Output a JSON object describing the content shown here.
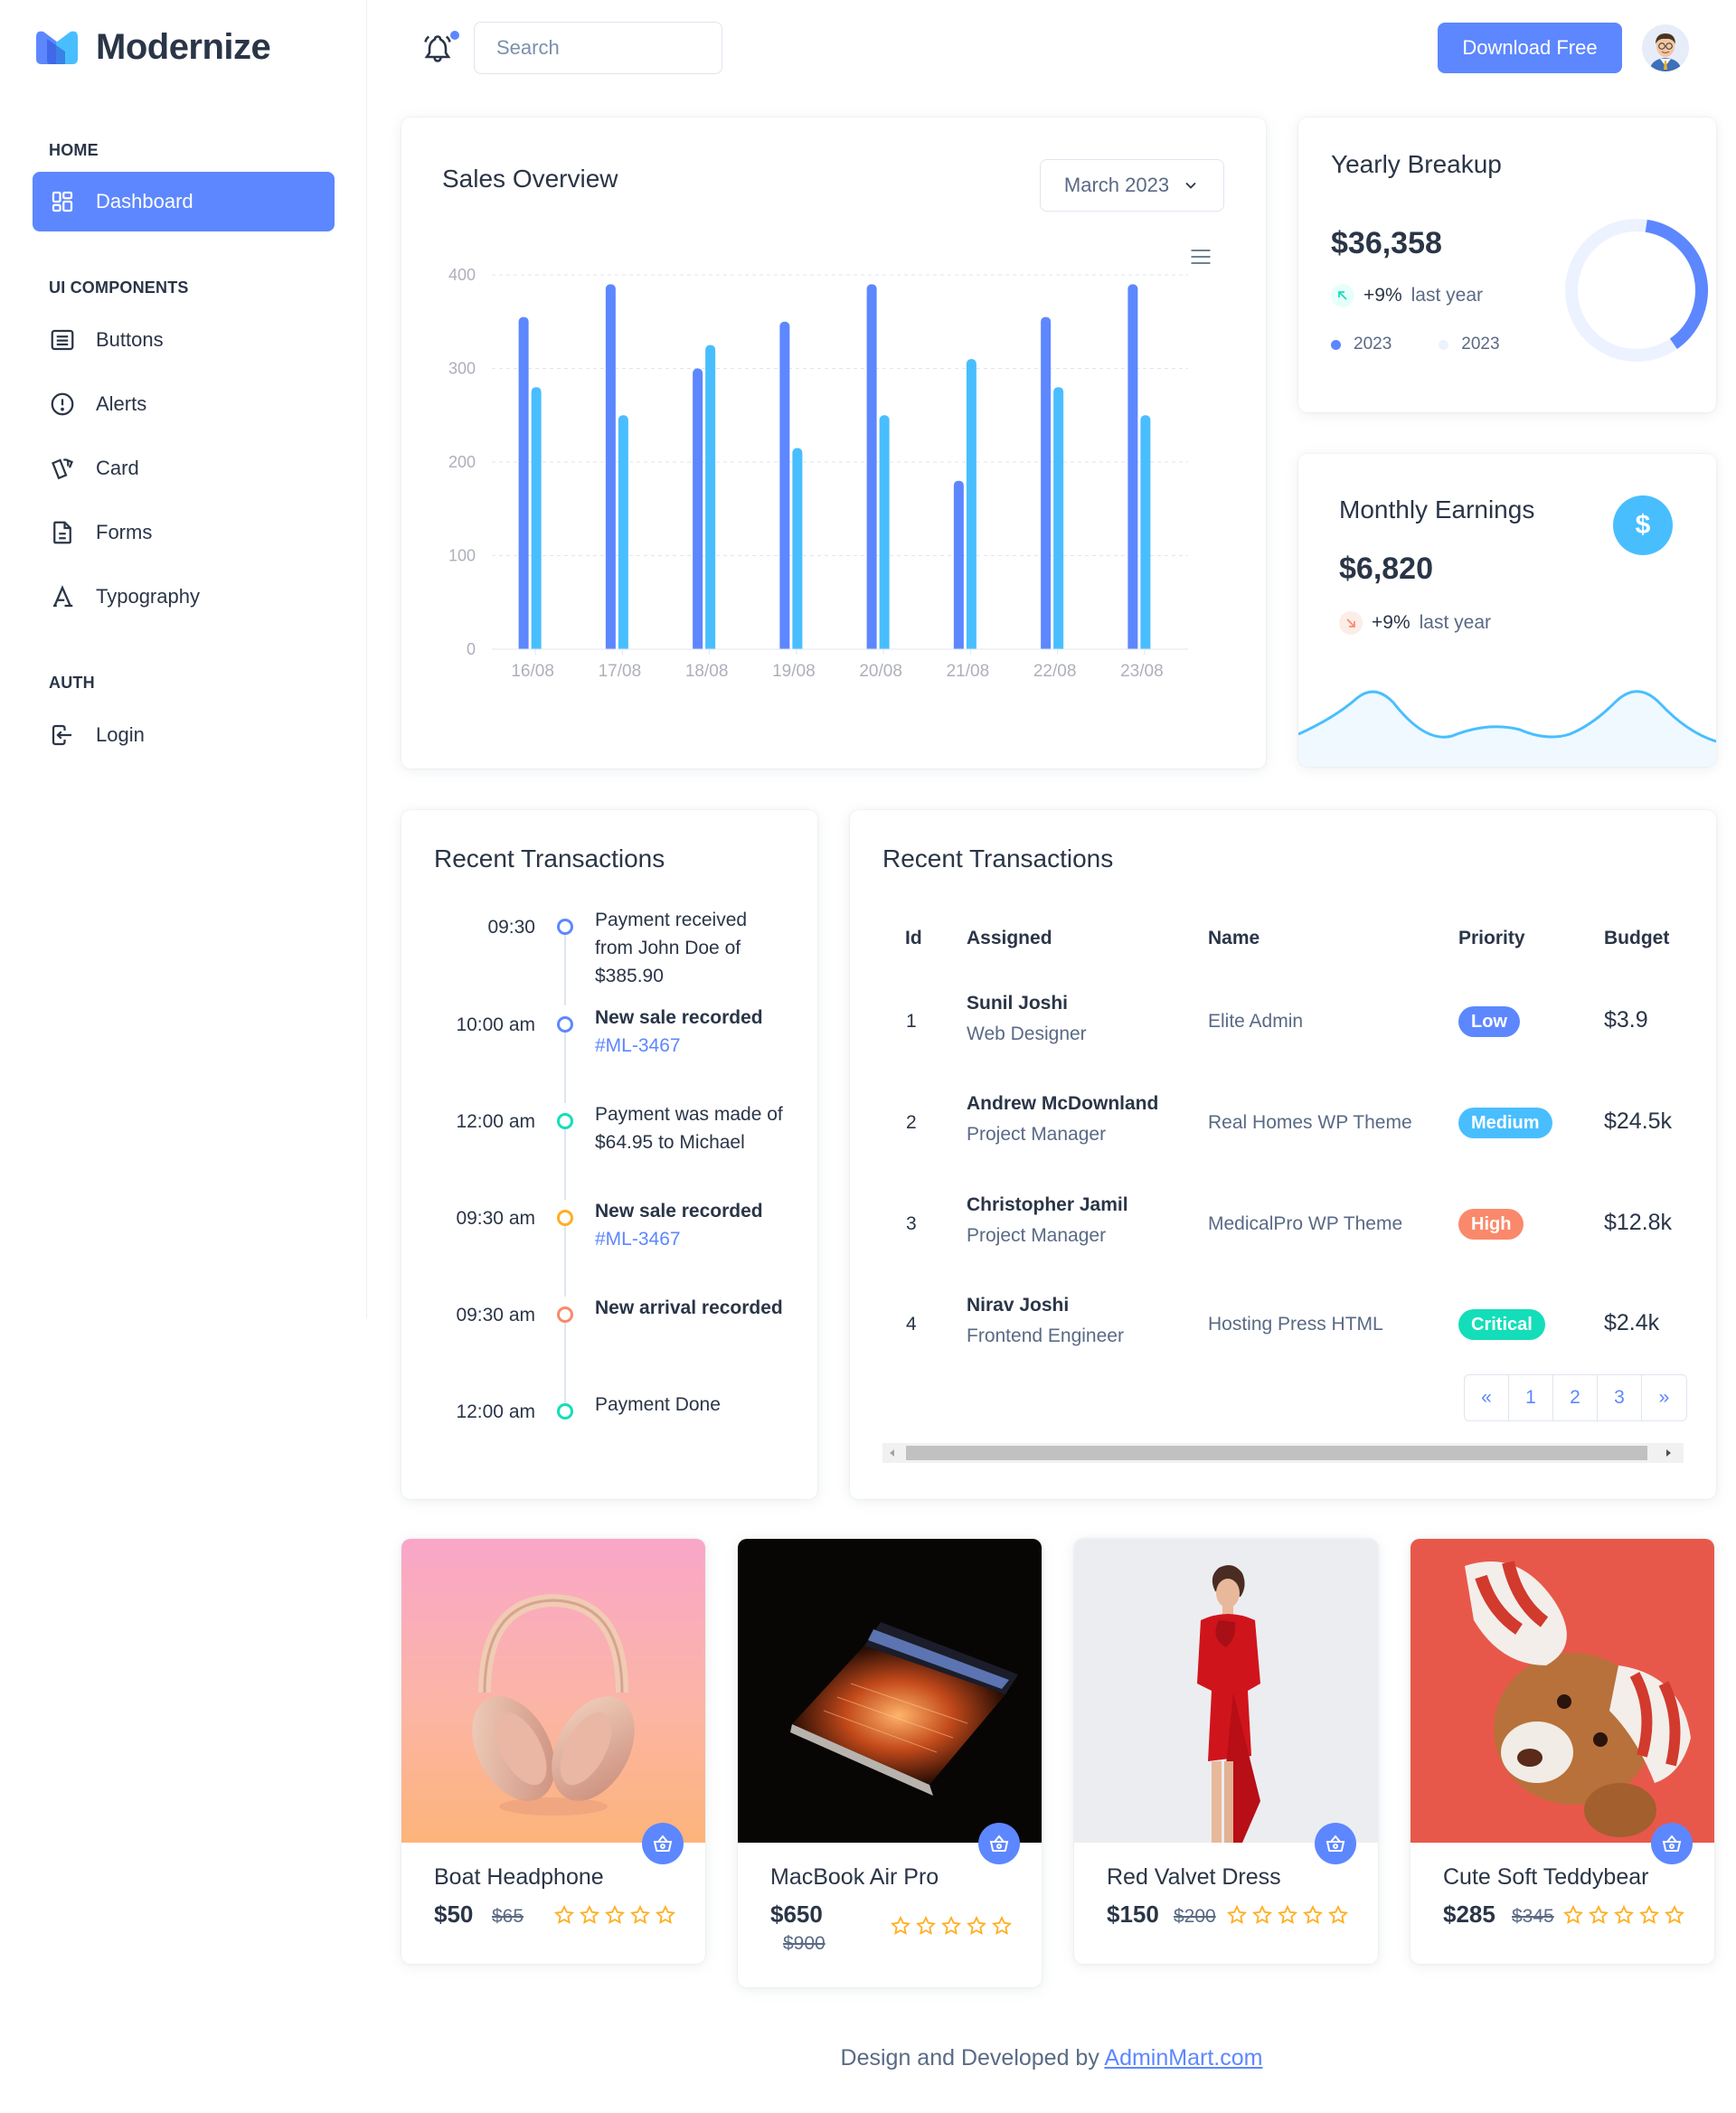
{
  "brand": {
    "name": "Modernize"
  },
  "sidebar": {
    "sections": [
      "HOME",
      "UI COMPONENTS",
      "AUTH"
    ],
    "items": [
      {
        "label": "Dashboard",
        "icon": "dashboard-icon"
      },
      {
        "label": "Buttons",
        "icon": "article-icon"
      },
      {
        "label": "Alerts",
        "icon": "alert-circle-icon"
      },
      {
        "label": "Card",
        "icon": "cards-icon"
      },
      {
        "label": "Forms",
        "icon": "file-description-icon"
      },
      {
        "label": "Typography",
        "icon": "typography-icon"
      },
      {
        "label": "Login",
        "icon": "login-icon"
      }
    ]
  },
  "header": {
    "search_placeholder": "Search",
    "download_label": "Download Free"
  },
  "sales_overview": {
    "title": "Sales Overview",
    "month": "March 2023"
  },
  "chart_data": {
    "type": "bar",
    "categories": [
      "16/08",
      "17/08",
      "18/08",
      "19/08",
      "20/08",
      "21/08",
      "22/08",
      "23/08"
    ],
    "series": [
      {
        "values": [
          355,
          390,
          300,
          350,
          390,
          180,
          355,
          390
        ]
      },
      {
        "values": [
          280,
          250,
          325,
          215,
          250,
          310,
          280,
          250
        ]
      }
    ],
    "ylim": [
      0,
      400
    ],
    "yticks": [
      0,
      100,
      200,
      300,
      400
    ],
    "colors": [
      "#5d87ff",
      "#49beff"
    ],
    "grid": true
  },
  "yearly": {
    "title": "Yearly Breakup",
    "amount": "$36,358",
    "pct": "+9%",
    "sub": "last year",
    "legend": [
      "2023",
      "2023"
    ],
    "donut_fraction": 0.38
  },
  "monthly": {
    "title": "Monthly Earnings",
    "amount": "$6,820",
    "pct": "+9%",
    "sub": "last year"
  },
  "timeline": {
    "title": "Recent Transactions",
    "items": [
      {
        "time": "09:30",
        "color": "#5d87ff",
        "text": "Payment received from John Doe of $385.90"
      },
      {
        "time": "10:00 am",
        "color": "#5d87ff",
        "text": "New sale recorded",
        "link": "#ML-3467"
      },
      {
        "time": "12:00 am",
        "color": "#13deb9",
        "text": "Payment was made of $64.95 to Michael"
      },
      {
        "time": "09:30 am",
        "color": "#ffae1f",
        "text": "New sale recorded",
        "link": "#ML-3467"
      },
      {
        "time": "09:30 am",
        "color": "#fa896b",
        "text": "New arrival recorded"
      },
      {
        "time": "12:00 am",
        "color": "#13deb9",
        "text": "Payment Done"
      }
    ]
  },
  "table": {
    "title": "Recent Transactions",
    "headers": [
      "Id",
      "Assigned",
      "Name",
      "Priority",
      "Budget"
    ],
    "rows": [
      {
        "id": "1",
        "assigned": "Sunil Joshi",
        "role": "Web Designer",
        "name": "Elite Admin",
        "priority": "Low",
        "priority_color": "#5d87ff",
        "budget": "$3.9"
      },
      {
        "id": "2",
        "assigned": "Andrew McDownland",
        "role": "Project Manager",
        "name": "Real Homes WP Theme",
        "priority": "Medium",
        "priority_color": "#49beff",
        "budget": "$24.5k"
      },
      {
        "id": "3",
        "assigned": "Christopher Jamil",
        "role": "Project Manager",
        "name": "MedicalPro WP Theme",
        "priority": "High",
        "priority_color": "#fa896b",
        "budget": "$12.8k"
      },
      {
        "id": "4",
        "assigned": "Nirav Joshi",
        "role": "Frontend Engineer",
        "name": "Hosting Press HTML",
        "priority": "Critical",
        "priority_color": "#13deb9",
        "budget": "$2.4k"
      }
    ],
    "pagination": [
      "«",
      "1",
      "2",
      "3",
      "»"
    ]
  },
  "products": [
    {
      "name": "Boat Headphone",
      "price": "$50",
      "old": "$65"
    },
    {
      "name": "MacBook Air Pro",
      "price": "$650",
      "old": "$900"
    },
    {
      "name": "Red Valvet Dress",
      "price": "$150",
      "old": "$200"
    },
    {
      "name": "Cute Soft Teddybear",
      "price": "$285",
      "old": "$345"
    }
  ],
  "footer": {
    "text": "Design and Developed by ",
    "link": "AdminMart.com"
  }
}
